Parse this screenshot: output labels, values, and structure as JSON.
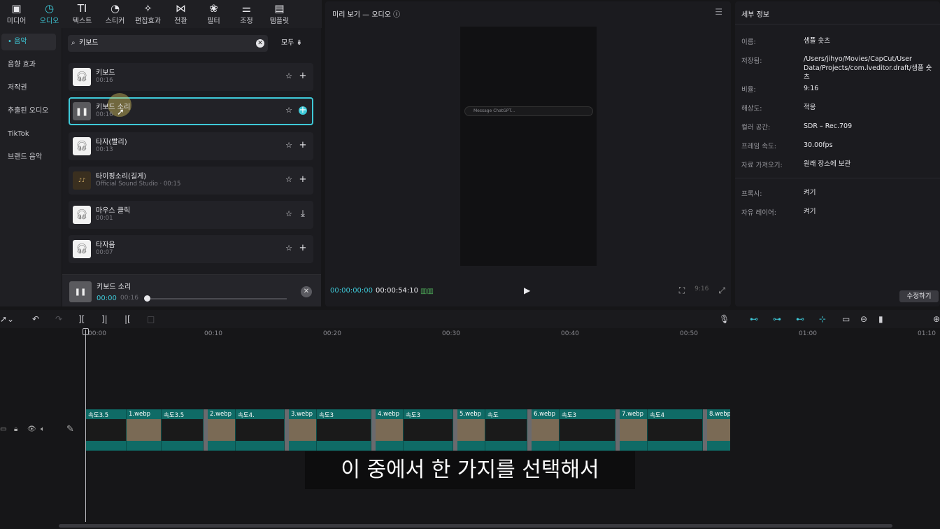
{
  "toolbar": [
    {
      "label": "미디어",
      "icon": "media-icon",
      "glyph": "▣"
    },
    {
      "label": "오디오",
      "icon": "audio-icon",
      "glyph": "◷"
    },
    {
      "label": "텍스트",
      "icon": "text-icon",
      "glyph": "TI"
    },
    {
      "label": "스티커",
      "icon": "sticker-icon",
      "glyph": "◔"
    },
    {
      "label": "편집효과",
      "icon": "effects-icon",
      "glyph": "✧"
    },
    {
      "label": "전환",
      "icon": "transition-icon",
      "glyph": "⋈"
    },
    {
      "label": "필터",
      "icon": "filter-icon",
      "glyph": "❀"
    },
    {
      "label": "조정",
      "icon": "adjust-icon",
      "glyph": "⚌"
    },
    {
      "label": "템플릿",
      "icon": "template-icon",
      "glyph": "▤"
    }
  ],
  "sidebar": [
    {
      "label": "• 음악"
    },
    {
      "label": "음향 효과"
    },
    {
      "label": "저작권"
    },
    {
      "label": "추출된 오디오"
    },
    {
      "label": "TikTok"
    },
    {
      "label": "브랜드 음악"
    }
  ],
  "search": {
    "value": "키보드",
    "filter_label": "모두 ⇟"
  },
  "results": [
    {
      "title": "키보드",
      "duration": "00:16"
    },
    {
      "title": "키보드 소리",
      "duration": "00:16"
    },
    {
      "title": "타자(빨리)",
      "duration": "00:13"
    },
    {
      "title": "타이핑소리(길게)",
      "duration": "Official Sound Studio · 00:15"
    },
    {
      "title": "마우스 클릭",
      "duration": "00:01"
    },
    {
      "title": "타자음",
      "duration": "00:07"
    }
  ],
  "player": {
    "title": "키보드 소리",
    "current": "00:00",
    "total": "00:16"
  },
  "preview": {
    "title": "미리 보기 — 오디오",
    "chat_placeholder": "Message ChatGPT...",
    "current_time": "00:00:00:00",
    "duration": "00:00:54:10",
    "ratio_label": "9:16"
  },
  "details": {
    "header": "세부 정보",
    "rows": [
      {
        "label": "이름:",
        "value": "샘플 숏츠"
      },
      {
        "label": "저장됨:",
        "value": "/Users/jihyo/Movies/CapCut/User Data/Projects/com.lveditor.draft/샘플 숏츠"
      },
      {
        "label": "비율:",
        "value": "9:16"
      },
      {
        "label": "해상도:",
        "value": "적응"
      },
      {
        "label": "컬러 공간:",
        "value": "SDR – Rec.709"
      },
      {
        "label": "프레임 속도:",
        "value": "30.00fps"
      },
      {
        "label": "자료 가져오기:",
        "value": "원래 장소에 보관"
      },
      {
        "label": "프록시:",
        "value": "켜기"
      },
      {
        "label": "자유 레이어:",
        "value": "켜기"
      }
    ],
    "edit_label": "수정하기"
  },
  "ruler": [
    "00:00",
    "00:10",
    "00:20",
    "00:30",
    "00:40",
    "00:50",
    "01:00",
    "01:10"
  ],
  "clips": [
    {
      "label": "속도3.5",
      "kind": "dark"
    },
    {
      "label": "1.webp",
      "kind": "img"
    },
    {
      "label": "속도3.5",
      "kind": "dark"
    },
    {
      "label": "2.webp",
      "kind": "img"
    },
    {
      "label": "속도4.",
      "kind": "dark"
    },
    {
      "label": "3.webp",
      "kind": "img"
    },
    {
      "label": "속도3",
      "kind": "dark"
    },
    {
      "label": "4.webp",
      "kind": "img"
    },
    {
      "label": "속도3",
      "kind": "dark"
    },
    {
      "label": "5.webp",
      "kind": "img"
    },
    {
      "label": "속도",
      "kind": "dark"
    },
    {
      "label": "6.webp",
      "kind": "img"
    },
    {
      "label": "속도3",
      "kind": "dark"
    },
    {
      "label": "7.webp",
      "kind": "img"
    },
    {
      "label": "속도4",
      "kind": "dark"
    },
    {
      "label": "8.webp",
      "kind": "img"
    }
  ],
  "caption": "이 중에서 한 가지를 선택해서",
  "colors": {
    "accent": "#3ec9d8",
    "track": "#0f6b66"
  }
}
